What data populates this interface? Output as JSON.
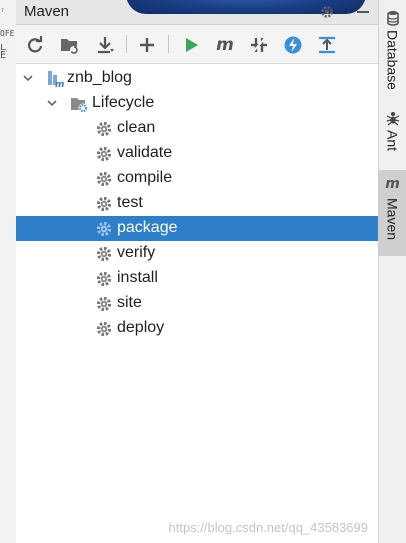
{
  "window": {
    "title": "Maven"
  },
  "left_gutter": {
    "lines": [
      "₇",
      "OFE",
      "L E"
    ]
  },
  "toolbar": {
    "items": [
      "refresh-icon",
      "add-maven-project-icon",
      "download-icon",
      "plus-icon",
      "run-icon",
      "execute-goal-icon",
      "toggle-skip-tests-icon",
      "lightning-icon",
      "collapse-icon"
    ]
  },
  "tree": {
    "project": {
      "label": "znb_blog"
    },
    "lifecycle": {
      "label": "Lifecycle"
    },
    "goals": [
      {
        "label": "clean",
        "selected": false
      },
      {
        "label": "validate",
        "selected": false
      },
      {
        "label": "compile",
        "selected": false
      },
      {
        "label": "test",
        "selected": false
      },
      {
        "label": "package",
        "selected": true
      },
      {
        "label": "verify",
        "selected": false
      },
      {
        "label": "install",
        "selected": false
      },
      {
        "label": "site",
        "selected": false
      },
      {
        "label": "deploy",
        "selected": false
      }
    ]
  },
  "right_strip": {
    "tabs": [
      {
        "label": "Database",
        "icon": "database-icon",
        "active": false
      },
      {
        "label": "Ant",
        "icon": "ant-icon",
        "active": false
      },
      {
        "label": "Maven",
        "icon": "maven-icon",
        "active": true
      }
    ]
  },
  "watermark": "https://blog.csdn.net/qq_43583699",
  "colors": {
    "selection": "#2f7ec8",
    "run": "#3aa65a",
    "accent_blue": "#3b8fd9"
  }
}
